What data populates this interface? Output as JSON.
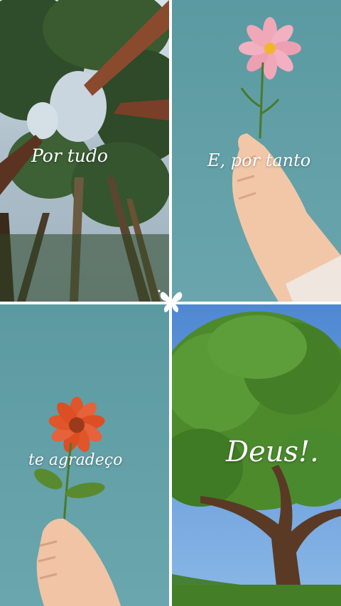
{
  "captions": {
    "top_left": "Por tudo",
    "top_right": "E, por tanto",
    "bottom_left": "te agradeço",
    "bottom_right": "Deus!."
  },
  "icons": {
    "center": "butterfly-icon"
  },
  "colors": {
    "sky_teal": "#5f9aa3",
    "sky_blue": "#5b93d6",
    "foliage": "#4c8a2c",
    "trunk": "#8a4a2e",
    "pink_petal": "#f0a8b8",
    "red_petal": "#e0552a",
    "caption": "#ffffff"
  }
}
